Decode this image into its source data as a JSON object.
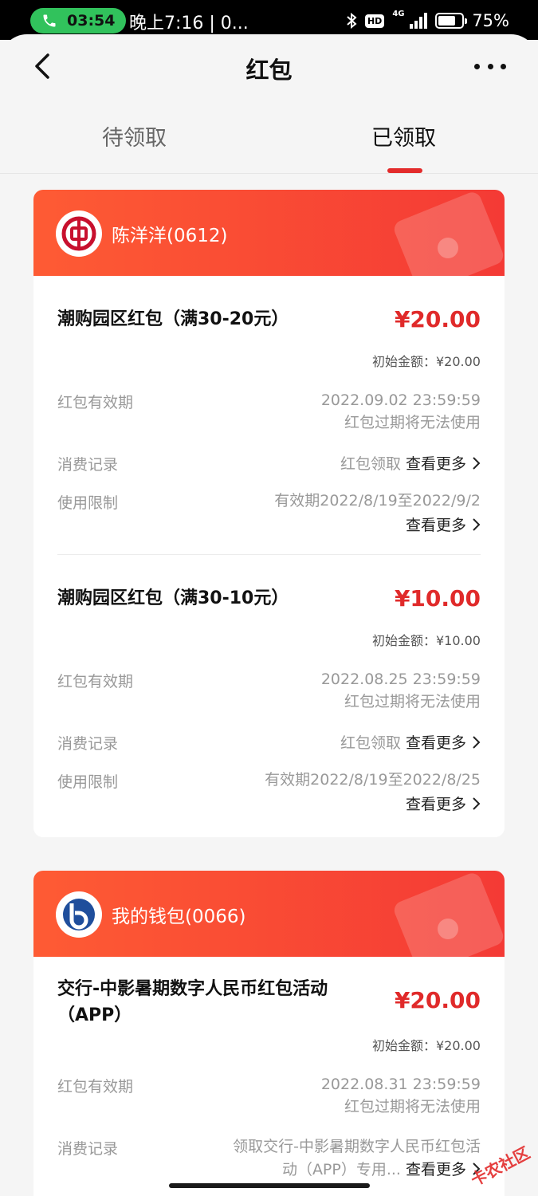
{
  "status_bar": {
    "call_time": "03:54",
    "notification_text": "晚上7:16 | 0...",
    "hd": "HD",
    "network": "4G",
    "battery": "75%",
    "battery_level": 0.75
  },
  "header": {
    "title": "红包",
    "tabs": [
      {
        "label": "待领取",
        "active": false
      },
      {
        "label": "已领取",
        "active": true
      }
    ]
  },
  "cards": [
    {
      "holder": "陈洋洋(0612)",
      "bank_logo": "boc-logo",
      "entries": [
        {
          "title": "潮购园区红包（满30-20元）",
          "amount": "¥20.00",
          "initial": "初始金额：¥20.00",
          "validity_label": "红包有效期",
          "validity_value": "2022.09.02 23:59:59",
          "validity_note": "红包过期将无法使用",
          "consume_label": "消费记录",
          "consume_value": "红包领取",
          "see_more": "查看更多",
          "limit_label": "使用限制",
          "limit_value": "有效期2022/8/19至2022/9/2"
        },
        {
          "title": "潮购园区红包（满30-10元）",
          "amount": "¥10.00",
          "initial": "初始金额：¥10.00",
          "validity_label": "红包有效期",
          "validity_value": "2022.08.25 23:59:59",
          "validity_note": "红包过期将无法使用",
          "consume_label": "消费记录",
          "consume_value": "红包领取",
          "see_more": "查看更多",
          "limit_label": "使用限制",
          "limit_value": "有效期2022/8/19至2022/8/25"
        }
      ]
    },
    {
      "holder": "我的钱包(0066)",
      "bank_logo": "bocom-logo",
      "entries": [
        {
          "title": "交行-中影暑期数字人民币红包活动（APP）",
          "amount": "¥20.00",
          "initial": "初始金额：¥20.00",
          "validity_label": "红包有效期",
          "validity_value": "2022.08.31 23:59:59",
          "validity_note": "红包过期将无法使用",
          "consume_label": "消费记录",
          "consume_value_line1": "领取交行-中影暑期数字人民币红包活",
          "consume_value_line2": "动（APP）专用...",
          "see_more": "查看更多"
        }
      ]
    }
  ],
  "watermark": "卡农社区",
  "colors": {
    "accent": "#e32b2b",
    "header_gradient_start": "#fe5b34",
    "header_gradient_end": "#f43a35",
    "call_pill": "#31c25c"
  }
}
